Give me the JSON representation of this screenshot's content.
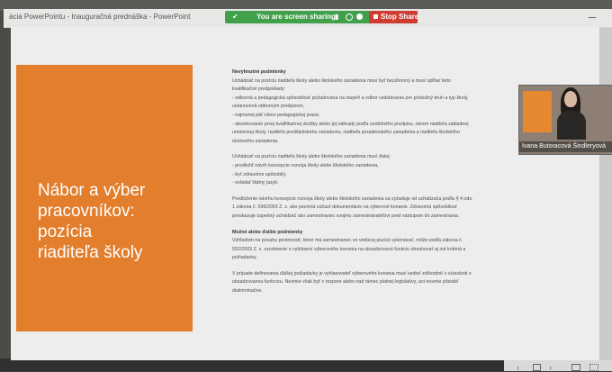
{
  "window": {
    "title": "ácia PowerPointu  -  Inauguračná prednáška  -  PowerPoint"
  },
  "sharing": {
    "status": "You are screen sharing",
    "stop_label": "Stop Share",
    "bar_color": "#41a04a",
    "stop_color": "#d03b32"
  },
  "slide": {
    "accent_color": "#e27e2c",
    "title_lines": [
      "Nábor a výber",
      "pracovníkov:",
      "pozícia",
      "riaditeľa školy"
    ],
    "blocks": [
      {
        "heading": "Nevyhnutné podmienky",
        "lines": [
          "Uchádzač na pozíciu riaditeľa školy alebo školského zariadenia musí byť bezúhonný a musí spĺňať tieto",
          "kvalifikačné predpoklady:",
          "- odborná a pedagogická spôsobilosť požadovaná na stupeň a odbor vzdelávania pre príslušný druh a typ školy,",
          "  ustanovená odborným predpisom,",
          "- najmenej päť rokov pedagogickej praxe,",
          "- absolvovanie prvej kvalifikačnej skúšky alebo jej náhrady podľa osobitného predpisu, okrem riaditeľa základnej",
          "  umeleckej školy, riaditeľa predškolského zariadenia, riaditeľa poradenského zariadenia a riaditeľa školského",
          "  účelového zariadenia."
        ]
      },
      {
        "heading": "",
        "lines": [
          "Uchádzač na pozíciu riaditeľa školy alebo školského zariadenia musí ďalej:",
          "- predložiť návrh koncepcie rozvoja školy alebo školského zariadenia,",
          "- byť zdravotne spôsobilý,",
          "- ovládať štátny jazyk."
        ]
      },
      {
        "heading": "",
        "lines": [
          "Predloženie návrhu koncepcie rozvoja školy alebo školského zariadenia sa vyžaduje od uchádzača podľa § 4 ods.",
          "1 zákona č. 596/2003 Z. z. ako povinná súčasť dokumentácie na výberové konanie. Zdravotnú spôsobilosť",
          "preukazuje úspešný uchádzač ako zamestnanec svojmu zamestnávateľovi pred nástupom do zamestnania."
        ]
      },
      {
        "heading": "Možné alebo ďalšie podmienky",
        "lines": [
          "Vzhľadom na povahu povinností, ktoré má zamestnanec vo vedúcej pozícii vykonávať, môže podľa zákona č.",
          "552/2003 Z. z. oznámenie o vyhlásení výberového konania na obsadzovanú funkciu obsahovať aj iné kritériá a",
          "požiadavky."
        ]
      },
      {
        "heading": "",
        "lines": [
          "V prípade definovania ďalšej požiadavky je vyhlasovateľ výberového konania musí vedieť zdôvodniť v súvislosti s",
          "obsadzovanou funkciou. Nesmie však byť v rozpore alebo nad rámec platnej legislatívy, ani nesmie pôsobiť",
          "diskriminačne."
        ]
      }
    ]
  },
  "video": {
    "participant_name": "Ivana Butoracová Šindleryová"
  },
  "icons": {
    "share": "leaf-icon",
    "mic": "microphone-icon",
    "camera": "camera-icon",
    "stop": "stop-square-icon",
    "prev": "chevron-left-icon",
    "next": "chevron-right-icon"
  }
}
